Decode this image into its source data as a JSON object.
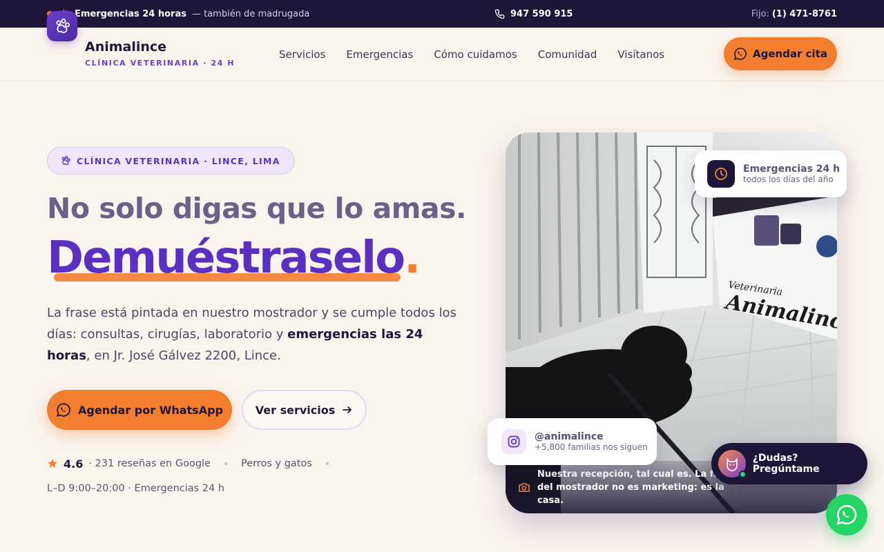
{
  "topbar": {
    "emergency_label": "Emergencias 24 horas",
    "emergency_sub": "— también de madrugada",
    "phone": "947 590 915",
    "landline_label": "Fijo:",
    "landline_number": "(1) 471-8761"
  },
  "header": {
    "brand_name": "Animalince",
    "brand_tagline": "CLÍNICA VETERINARIA · 24 H",
    "nav": [
      "Servicios",
      "Emergencias",
      "Cómo cuidamos",
      "Comunidad",
      "Visítanos"
    ],
    "cta_label": "Agendar cita"
  },
  "hero": {
    "pill": "CLÍNICA VETERINARIA · LINCE, LIMA",
    "headline_1": "No solo digas que lo amas.",
    "headline_2": "Demuéstraselo",
    "headline_2_period": ".",
    "lead_1": "La frase está pintada en nuestro mostrador y se cumple todos los días: consultas, cirugías, laboratorio y ",
    "lead_bold": "emergencias las 24 horas",
    "lead_2": ", en Jr. José Gálvez 2200, Lince.",
    "btn_whatsapp": "Agendar por WhatsApp",
    "btn_services": "Ver servicios",
    "rating_value": "4.6",
    "rating_text": "· 231 reseñas en Google",
    "pets": "Perros y gatos",
    "hours": "L–D 9:00–20:00 · Emergencias 24 h"
  },
  "photo": {
    "sign_line1": "Veterinaria",
    "sign_line2": "Animalince",
    "caption": "Nuestra recepción, tal cual es. La frase del mostrador no es marketing: es la casa."
  },
  "cards": {
    "emergency_title": "Emergencias 24 h",
    "emergency_sub": "todos los días del año",
    "instagram_handle": "@animalince",
    "instagram_sub": "+5,800 familias nos siguen"
  },
  "chat": {
    "label": "¿Dudas? Pregúntame"
  },
  "colors": {
    "accent": "#f47e2f",
    "brand": "#5b2fc0",
    "dark": "#1e1638",
    "whatsapp": "#25d366"
  }
}
